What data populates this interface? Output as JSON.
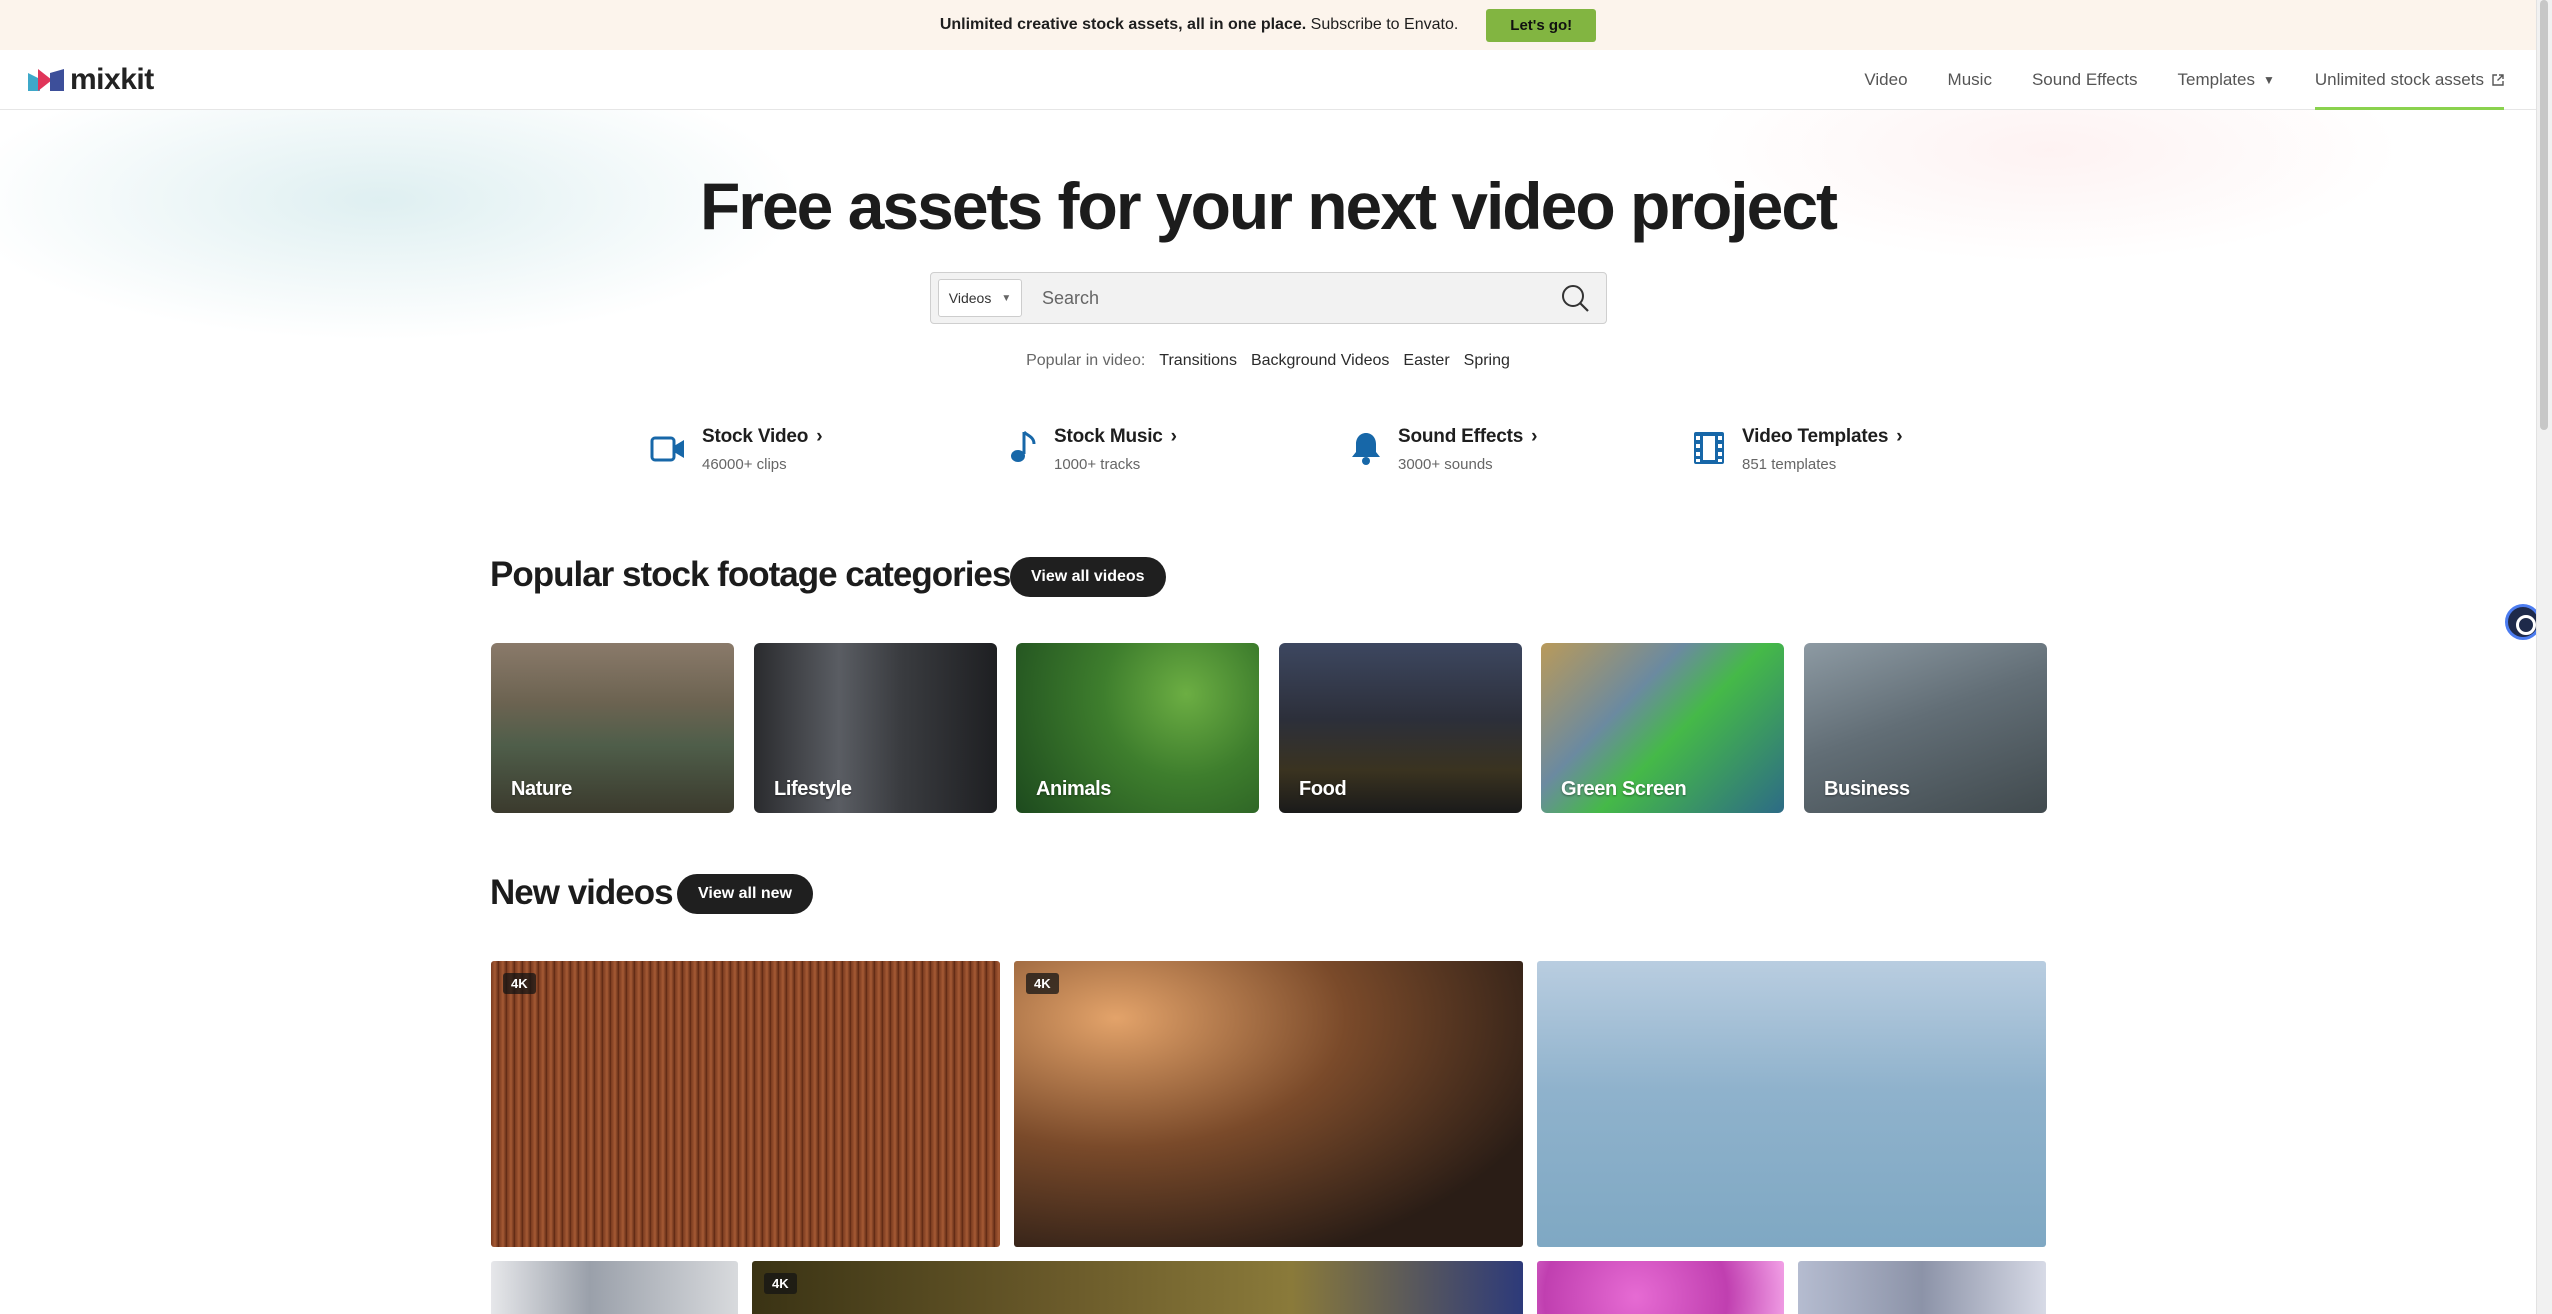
{
  "promo": {
    "bold_text": "Unlimited creative stock assets, all in one place.",
    "text": "Subscribe to Envato.",
    "cta": "Let's go!"
  },
  "header": {
    "logo": "mixkit",
    "nav": [
      {
        "label": "Video"
      },
      {
        "label": "Music"
      },
      {
        "label": "Sound Effects"
      },
      {
        "label": "Templates"
      },
      {
        "label": "Unlimited stock assets"
      }
    ]
  },
  "hero": {
    "title": "Free assets for your next video project",
    "search_type": "Videos",
    "search_placeholder": "Search",
    "popular_label": "Popular in video:",
    "popular_tags": [
      "Transitions",
      "Background Videos",
      "Easter",
      "Spring"
    ]
  },
  "quick_links": [
    {
      "title": "Stock Video",
      "sub": "46000+ clips",
      "icon": "video-camera-icon"
    },
    {
      "title": "Stock Music",
      "sub": "1000+ tracks",
      "icon": "music-note-icon"
    },
    {
      "title": "Sound Effects",
      "sub": "3000+ sounds",
      "icon": "bell-icon"
    },
    {
      "title": "Video Templates",
      "sub": "851 templates",
      "icon": "film-strip-icon"
    }
  ],
  "categories_section": {
    "title": "Popular stock footage categories",
    "button": "View all videos",
    "items": [
      {
        "label": "Nature"
      },
      {
        "label": "Lifestyle"
      },
      {
        "label": "Animals"
      },
      {
        "label": "Food"
      },
      {
        "label": "Green Screen"
      },
      {
        "label": "Business"
      }
    ]
  },
  "new_videos": {
    "title": "New videos",
    "button": "View all new",
    "badges": [
      "4K",
      "4K",
      "4K"
    ]
  },
  "colors": {
    "accent_green": "#82b541",
    "nav_active": "#8ad24e",
    "icon_blue": "#1767a8",
    "dark_pill": "#1f1f1f"
  }
}
